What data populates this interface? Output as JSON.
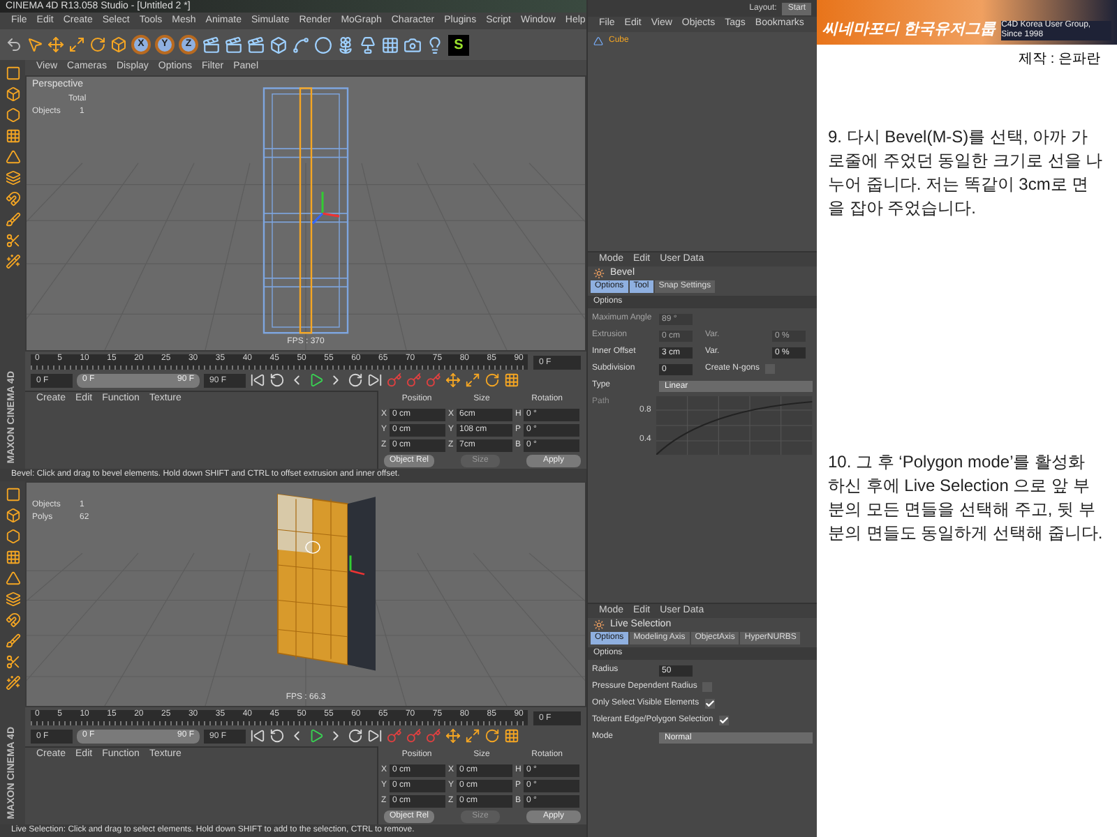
{
  "window": {
    "title": "CINEMA 4D R13.058 Studio - [Untitled 2 *]"
  },
  "menu": [
    "File",
    "Edit",
    "Create",
    "Select",
    "Tools",
    "Mesh",
    "Animate",
    "Simulate",
    "Render",
    "MoGraph",
    "Character",
    "Plugins",
    "Script",
    "Window",
    "Help"
  ],
  "toolbar": {
    "axes": [
      "X",
      "Y",
      "Z"
    ],
    "logo": "S"
  },
  "layout": {
    "label": "Layout:",
    "value": "Start"
  },
  "object_manager": {
    "menu": [
      "File",
      "Edit",
      "View",
      "Objects",
      "Tags",
      "Bookmarks"
    ],
    "objects": [
      {
        "name": "Cube",
        "selected": true
      }
    ]
  },
  "shots": [
    {
      "viewport": {
        "menu": [
          "View",
          "Cameras",
          "Display",
          "Options",
          "Filter",
          "Panel"
        ],
        "camera": "Perspective",
        "kind": "frame",
        "hud": {
          "title": "Total",
          "rows": [
            {
              "label": "Objects",
              "value": "1"
            }
          ]
        },
        "fps": "FPS : 370"
      },
      "brand": "MAXON CINEMA 4D",
      "timeline": {
        "ticks": [
          "0",
          "5",
          "10",
          "15",
          "20",
          "25",
          "30",
          "35",
          "40",
          "45",
          "50",
          "55",
          "60",
          "65",
          "70",
          "75",
          "80",
          "85",
          "90"
        ],
        "current": "0 F",
        "start": "0 F",
        "slider_start": "0 F",
        "slider_end": "90 F",
        "level": 1,
        "end": "90 F"
      },
      "materials": {
        "menu": [
          "Create",
          "Edit",
          "Function",
          "Texture"
        ]
      },
      "coordinates": {
        "headers": [
          "Position",
          "Size",
          "Rotation"
        ],
        "rows": [
          [
            {
              "axis": "X",
              "value": "0 cm"
            },
            {
              "axis": "X",
              "value": "6cm"
            },
            {
              "axis": "H",
              "value": "0 °"
            }
          ],
          [
            {
              "axis": "Y",
              "value": "0 cm"
            },
            {
              "axis": "Y",
              "value": "108 cm"
            },
            {
              "axis": "P",
              "value": "0 °"
            }
          ],
          [
            {
              "axis": "Z",
              "value": "0 cm"
            },
            {
              "axis": "Z",
              "value": "7cm"
            },
            {
              "axis": "B",
              "value": "0 °"
            }
          ]
        ],
        "mode": "Object Rel",
        "size_mode": "Size",
        "apply": "Apply"
      },
      "status": "Bevel: Click and drag to bevel elements. Hold down SHIFT and CTRL to offset extrusion and inner offset.",
      "attributes": {
        "menu": [
          "Mode",
          "Edit",
          "User Data"
        ],
        "tool": "Bevel",
        "tabs": [
          {
            "label": "Options",
            "selected": true
          },
          {
            "label": "Tool",
            "selected": true
          },
          {
            "label": "Snap Settings",
            "selected": false
          }
        ],
        "section": "Options",
        "rows": [
          [
            {
              "kind": "number",
              "label": "Maximum Angle",
              "value": "89 °",
              "disabled": true
            }
          ],
          [
            {
              "kind": "number",
              "label": "Extrusion",
              "value": "0 cm",
              "disabled": true
            },
            {
              "kind": "number",
              "label": "Var.",
              "value": "0 %",
              "disabled": true
            }
          ],
          [
            {
              "kind": "number",
              "label": "Inner Offset",
              "value": "3 cm",
              "disabled": false
            },
            {
              "kind": "number",
              "label": "Var.",
              "value": "0 %",
              "disabled": false
            }
          ],
          [
            {
              "kind": "number",
              "label": "Subdivision",
              "value": "0",
              "disabled": false
            },
            {
              "kind": "check",
              "label": "Create N-gons",
              "checked": false
            }
          ],
          [
            {
              "kind": "select",
              "label": "Type",
              "value": "Linear"
            }
          ],
          [
            {
              "kind": "curve",
              "label": "Path",
              "ticks": [
                "0.8",
                "0.4"
              ]
            }
          ]
        ]
      }
    },
    {
      "viewport": {
        "kind": "wall",
        "hud": {
          "rows": [
            {
              "label": "Objects",
              "value": "1"
            },
            {
              "label": "Polys",
              "value": "62"
            }
          ]
        },
        "fps": "FPS : 66.3"
      },
      "brand": "MAXON CINEMA 4D",
      "timeline": {
        "ticks": [
          "0",
          "5",
          "10",
          "15",
          "20",
          "25",
          "30",
          "35",
          "40",
          "45",
          "50",
          "55",
          "60",
          "65",
          "70",
          "75",
          "80",
          "85",
          "90"
        ],
        "current": "0 F",
        "start": "0 F",
        "slider_start": "0 F",
        "slider_end": "90 F",
        "level": 1,
        "end": "90 F"
      },
      "materials": {
        "menu": [
          "Create",
          "Edit",
          "Function",
          "Texture"
        ]
      },
      "coordinates": {
        "headers": [
          "Position",
          "Size",
          "Rotation"
        ],
        "rows": [
          [
            {
              "axis": "X",
              "value": "0 cm"
            },
            {
              "axis": "X",
              "value": "0 cm"
            },
            {
              "axis": "H",
              "value": "0 °"
            }
          ],
          [
            {
              "axis": "Y",
              "value": "0 cm"
            },
            {
              "axis": "Y",
              "value": "0 cm"
            },
            {
              "axis": "P",
              "value": "0 °"
            }
          ],
          [
            {
              "axis": "Z",
              "value": "0 cm"
            },
            {
              "axis": "Z",
              "value": "0 cm"
            },
            {
              "axis": "B",
              "value": "0 °"
            }
          ]
        ],
        "mode": "Object Rel",
        "size_mode": "Size",
        "apply": "Apply"
      },
      "status": "Live Selection: Click and drag to select elements. Hold down SHIFT to add to the selection, CTRL to remove.",
      "attributes": {
        "menu": [
          "Mode",
          "Edit",
          "User Data"
        ],
        "tool": "Live Selection",
        "tabs": [
          {
            "label": "Options",
            "selected": true
          },
          {
            "label": "Modeling Axis",
            "selected": false
          },
          {
            "label": "ObjectAxis",
            "selected": false
          },
          {
            "label": "HyperNURBS",
            "selected": false
          }
        ],
        "section": "Options",
        "rows": [
          [
            {
              "kind": "number",
              "label": "Radius",
              "value": "50",
              "disabled": false
            }
          ],
          [
            {
              "kind": "check",
              "label": "Pressure Dependent Radius",
              "checked": false
            }
          ],
          [
            {
              "kind": "check",
              "label": "Only Select Visible Elements",
              "checked": true
            }
          ],
          [
            {
              "kind": "check",
              "label": "Tolerant Edge/Polygon Selection",
              "checked": true
            }
          ],
          [
            {
              "kind": "select",
              "label": "Mode",
              "value": "Normal"
            }
          ]
        ]
      }
    }
  ],
  "banner": {
    "title": "씨네마포디 한국유저그룹",
    "subtitle": "C4D Korea User Group, Since 1998",
    "credit": "제작 : 은파란"
  },
  "steps": [
    "9. 다시 Bevel(M-S)를 선택, 아까 가로줄에 주었던 동일한 크기로 선을 나누어 줍니다. 저는 똑같이 3cm로 면을 잡아 주었습니다.",
    "10. 그 후 ‘Polygon mode’를 활성화 하신 후에 Live Selection 으로 앞 부분의 모든 면들을 선택해 주고, 뒷 부분의 면들도 동일하게 선택해 줍니다."
  ]
}
